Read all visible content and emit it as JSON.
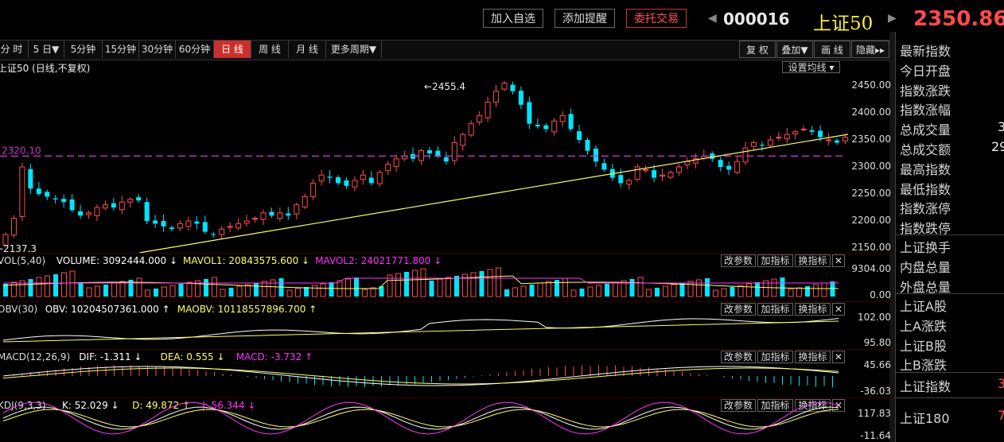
{
  "header": {
    "buttons": [
      "加入自选",
      "添加提醒",
      "委托交易"
    ],
    "code": "000016",
    "name": "上证50",
    "price": "2350.86",
    "prev_arrow": "◀",
    "next_arrow": "▶"
  },
  "toolbar": {
    "periods": [
      "分 时",
      "5 日▼",
      "5分钟",
      "15分钟",
      "30分钟",
      "60分钟",
      "日 线",
      "周 线",
      "月 线",
      "更多周期▼"
    ],
    "active": "日 线",
    "right": [
      "复 权",
      "叠加▼",
      "画 线",
      "隐藏▸▸"
    ]
  },
  "chart_title": "上证50 (日线,不复权)",
  "setting_ma": "设置均线 ▾",
  "price_axis": [
    "2450.00",
    "2400.00",
    "2350.00",
    "2300.00",
    "2250.00",
    "2200.00",
    "2150.00"
  ],
  "annotations": {
    "high": "2455.4",
    "low": "2137.3",
    "level": "2320.10"
  },
  "panels": {
    "vol": {
      "parts": [
        {
          "t": "VOL(5,40)",
          "c": "#dddddd"
        },
        {
          "t": "VOLUME: 3092444.000 ↓",
          "c": "#ffffff"
        },
        {
          "t": "MAVOL1: 20843575.600 ↓",
          "c": "#ffff66"
        },
        {
          "t": "MAVOL2: 24021771.800 ↓",
          "c": "#ff33ff"
        }
      ],
      "axis": [
        "9304.00",
        "0.00"
      ]
    },
    "obv": {
      "parts": [
        {
          "t": "OBV(30)",
          "c": "#dddddd"
        },
        {
          "t": "OBV: 10204507361.000 ↑",
          "c": "#ffffff"
        },
        {
          "t": "MAOBV: 10118557896.700 ↑",
          "c": "#ffff66"
        }
      ],
      "axis": [
        "102.00",
        "95.80"
      ]
    },
    "macd": {
      "parts": [
        {
          "t": "MACD(12,26,9)",
          "c": "#dddddd"
        },
        {
          "t": "DIF: -1.311 ↓",
          "c": "#ffffff"
        },
        {
          "t": "DEA: 0.555 ↓",
          "c": "#ffff66"
        },
        {
          "t": "MACD: -3.732 ↑",
          "c": "#ff33ff"
        }
      ],
      "axis": [
        "45.66",
        "-36.03"
      ]
    },
    "kdj": {
      "parts": [
        {
          "t": "KDJ(9,3,3)",
          "c": "#dddddd"
        },
        {
          "t": "K: 52.029 ↓",
          "c": "#ffffff"
        },
        {
          "t": "D: 49.872 ↑",
          "c": "#ffff66"
        },
        {
          "t": "J: 56.344 ↓",
          "c": "#ff33ff"
        }
      ],
      "axis": [
        "117.83",
        "-11.64"
      ]
    },
    "buttons": [
      "改参数",
      "加指标",
      "换指标",
      "✕"
    ]
  },
  "right_panel": {
    "group1": [
      "最新指数",
      "今日开盘",
      "指数涨跌",
      "指数涨幅",
      "总成交量",
      "总成交额",
      "最高指数",
      "最低指数",
      "指数涨停",
      "指数跌停"
    ],
    "group2": [
      "上证换手",
      "内盘总量",
      "外盘总量"
    ],
    "group3": [
      "上证A股",
      "上A涨跌",
      "上证B股",
      "上B涨跌"
    ],
    "group4": [
      "上证指数",
      "上证180"
    ],
    "partial_values": {
      "总成交量": "3",
      "总成交额": "29",
      "上证指数": "3",
      "上证180": "7"
    }
  },
  "colors": {
    "up": "#ff4d4d",
    "down": "#00e5ff",
    "ma": "#ffff66",
    "accent_red": "#ff4a4a"
  }
}
